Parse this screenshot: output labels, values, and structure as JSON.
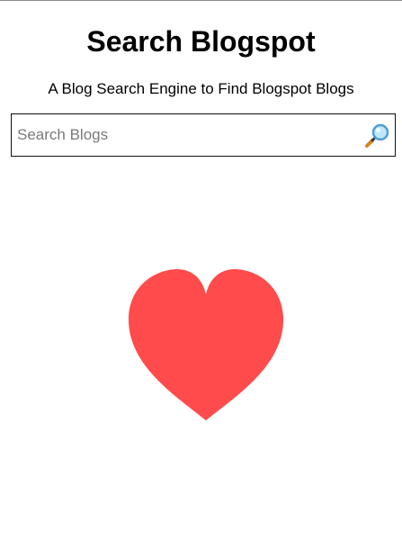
{
  "header": {
    "title": "Search Blogspot",
    "subtitle": "A Blog Search Engine to Find Blogspot Blogs"
  },
  "search": {
    "placeholder": "Search Blogs",
    "value": "",
    "button_icon": "magnifying-glass-icon"
  },
  "illustration": {
    "icon": "heart-icon",
    "color": "#ff4b4b"
  },
  "colors": {
    "background": "#ffffff",
    "text": "#000000",
    "heart": "#ff4b4b",
    "search_border": "#111111"
  }
}
